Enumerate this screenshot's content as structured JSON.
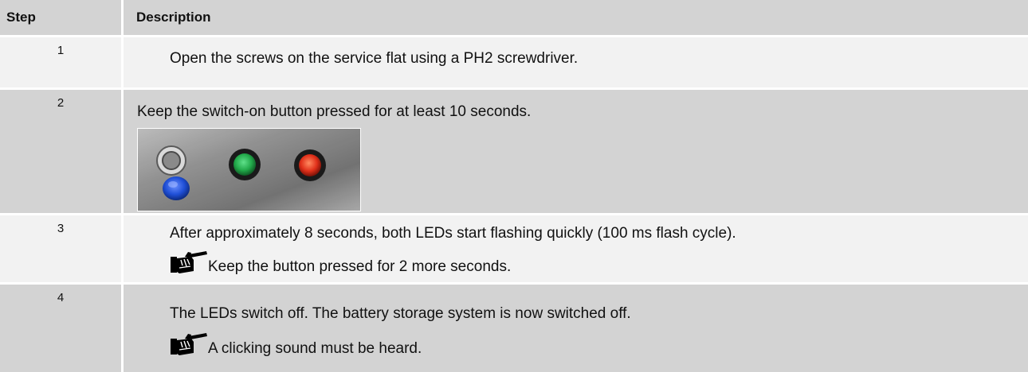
{
  "table": {
    "headers": {
      "step": "Step",
      "description": "Description"
    },
    "rows": [
      {
        "step": "1",
        "text": "Open the screws on the service flat using a PH2 screwdriver."
      },
      {
        "step": "2",
        "text": "Keep the switch-on button pressed for at least 10 seconds.",
        "image": "control-panel-photo"
      },
      {
        "step": "3",
        "text": "After approximately 8 seconds, both LEDs start flashing quickly (100 ms flash cycle).",
        "note": "Keep the button pressed for 2 more seconds.",
        "note_icon": "pointing-hand-icon"
      },
      {
        "step": "4",
        "text": "The LEDs switch off. The battery storage system is now switched off.",
        "note": "A clicking sound must be heard.",
        "note_icon": "pointing-hand-icon"
      }
    ]
  },
  "colors": {
    "header_bg": "#d3d3d3",
    "light_row_bg": "#f2f2f2",
    "dark_row_bg": "#d3d3d3",
    "text": "#111111",
    "blue_button": "#1f4fd6",
    "green_led": "#22a94a",
    "red_led": "#e0301a"
  }
}
